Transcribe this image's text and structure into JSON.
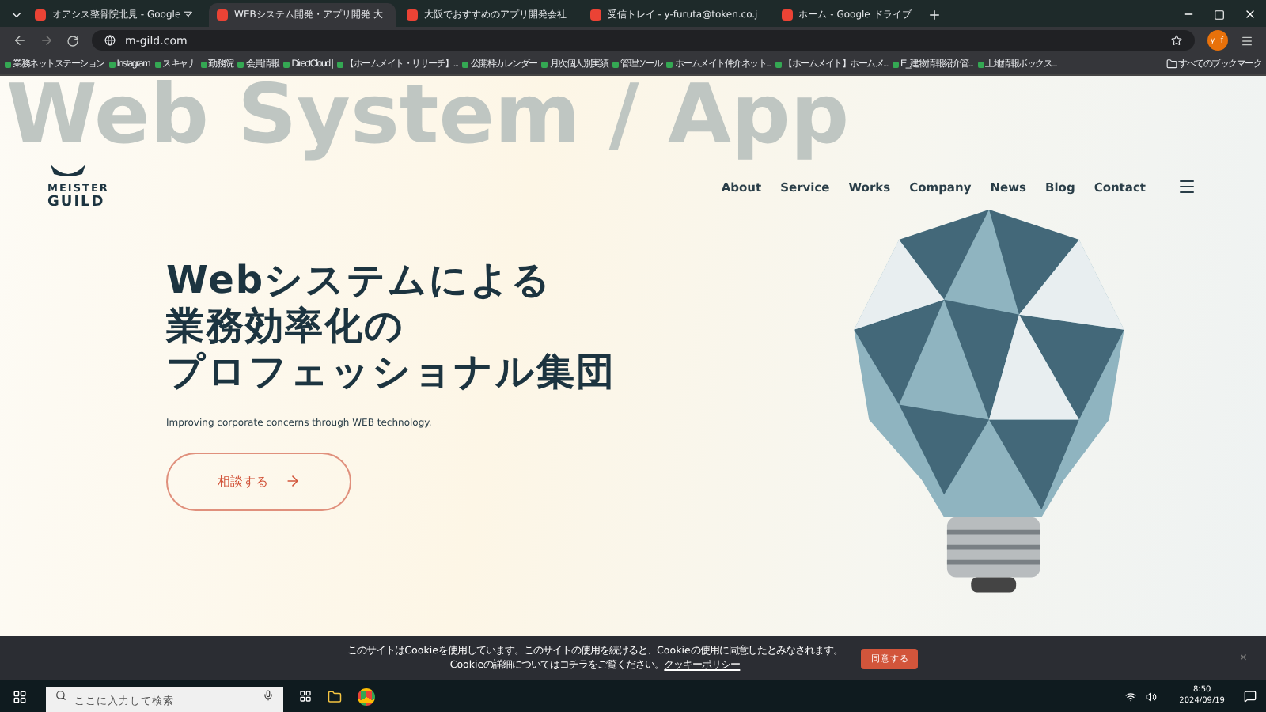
{
  "browser": {
    "tabs": [
      {
        "title": "オアシス整骨院北見 - Google マ",
        "selected": false
      },
      {
        "title": "WEBシステム開発・アプリ開発 大",
        "selected": true
      },
      {
        "title": "大阪でおすすめのアプリ開発会社",
        "selected": false
      },
      {
        "title": "受信トレイ - y-furuta@token.co.j",
        "selected": false
      },
      {
        "title": "ホーム - Google ドライブ",
        "selected": false
      }
    ],
    "url": "m-gild.com",
    "profile": "ｙｆ",
    "bookmarks": [
      "業務ネットステーション",
      "Instagram",
      "スキャナ",
      "勤務院",
      "会員情報",
      "DirectCloud |",
      "【ホームメイト・リサーチ】...",
      "公開枠カレンダー",
      "月次個人別実績",
      "管理ツール",
      "ホームメイト仲介ネット...",
      "【ホームメイト】ホームメ...",
      "E_建物情報紹介管...",
      "土地情報ボックス..."
    ],
    "all_bookmarks": "すべてのブックマーク"
  },
  "site": {
    "logo": {
      "line1": "MEISTER",
      "line2": "GUILD"
    },
    "watermark": "Web System / App",
    "nav": [
      "About",
      "Service",
      "Works",
      "Company",
      "News",
      "Blog",
      "Contact"
    ],
    "headline": [
      "Webシステムによる",
      "業務効率化の",
      "プロフェッショナル集団"
    ],
    "tagline": "Improving corporate concerns through WEB technology.",
    "cta": "相談する"
  },
  "cookie": {
    "line1": "このサイトはCookieを使用しています。このサイトの使用を続けると、Cookieの使用に同意したとみなされます。",
    "line2": "Cookieの詳細についてはコチラをご覧ください。",
    "link": "クッキーポリシー",
    "accept": "同意する",
    "close": "×"
  },
  "taskbar": {
    "search_placeholder": "ここに入力して検索",
    "time": "8:50",
    "date": "2024/09/19"
  }
}
